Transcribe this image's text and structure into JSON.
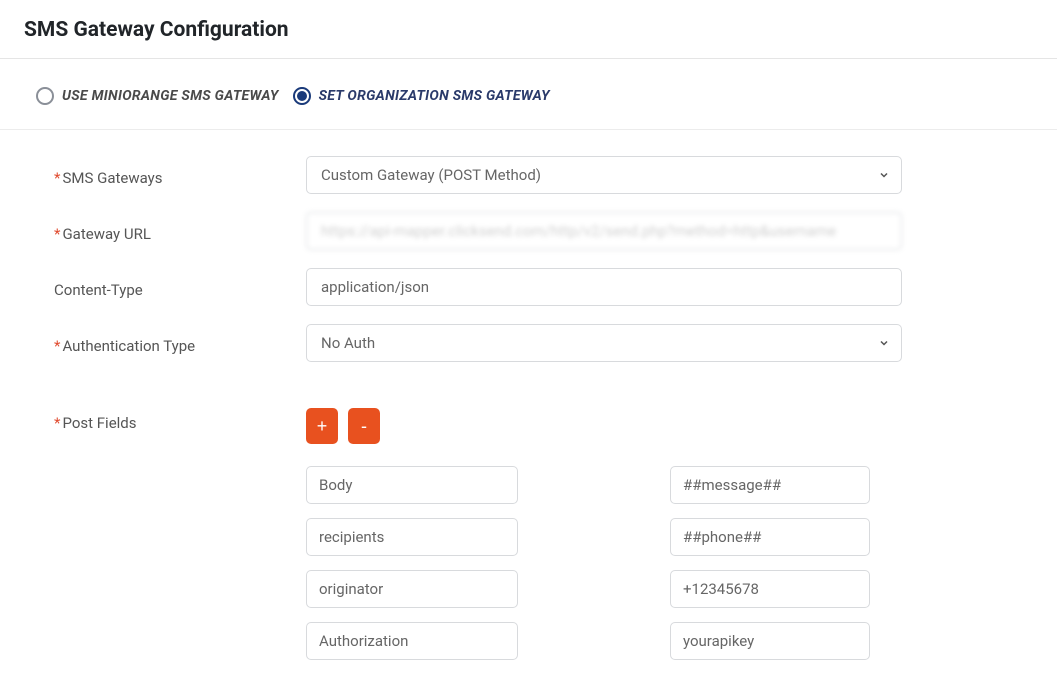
{
  "pageTitle": "SMS Gateway Configuration",
  "radios": {
    "miniorange": {
      "label": "USE MINIORANGE SMS GATEWAY",
      "selected": false
    },
    "organization": {
      "label": "SET ORGANIZATION SMS GATEWAY",
      "selected": true
    }
  },
  "form": {
    "smsGateways": {
      "label": "SMS Gateways",
      "value": "Custom Gateway (POST Method)"
    },
    "gatewayUrl": {
      "label": "Gateway URL",
      "value": "https://api-mapper.clicksend.com/http/v2/send.php?method=http&username"
    },
    "contentType": {
      "label": "Content-Type",
      "value": "application/json"
    },
    "authType": {
      "label": "Authentication Type",
      "value": "No Auth"
    },
    "postFields": {
      "label": "Post Fields",
      "addLabel": "+",
      "removeLabel": "-",
      "rows": [
        {
          "key": "Body",
          "value": "##message##"
        },
        {
          "key": "recipients",
          "value": "##phone##"
        },
        {
          "key": "originator",
          "value": "+12345678"
        },
        {
          "key": "Authorization",
          "value": "yourapikey"
        }
      ]
    }
  }
}
